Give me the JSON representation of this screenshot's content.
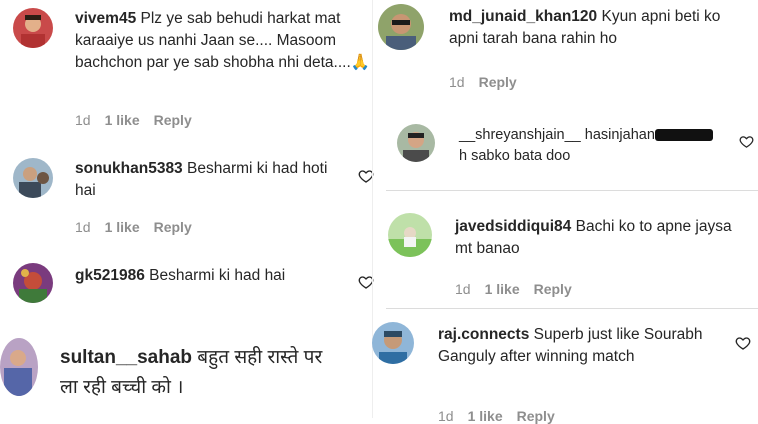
{
  "left": {
    "comments": [
      {
        "username": "vivem45",
        "text": "Plz ye sab behudi harkat mat karaaiye us nanhi Jaan se.... Masoom bachchon par ye sab shobha nhi deta....🙏",
        "time": "1d",
        "likes": "1 like",
        "reply": "Reply"
      },
      {
        "username": "sonukhan5383",
        "text": "Besharmi ki had hoti hai",
        "time": "1d",
        "likes": "1 like",
        "reply": "Reply"
      },
      {
        "username": "gk521986",
        "text": "Besharmi ki had hai"
      },
      {
        "username": "sultan__sahab",
        "text": "बहुत सही रास्ते पर ला रही बच्ची को ।"
      }
    ]
  },
  "right": {
    "comments": [
      {
        "username": "md_junaid_khan120",
        "text": "Kyun apni beti ko apni tarah bana rahin ho",
        "time": "1d",
        "reply": "Reply"
      },
      {
        "username": "__shreyanshjain__",
        "text_prefix": "hasinjahan",
        "text_suffix": "h sabko bata doo"
      },
      {
        "username": "javedsiddiqui84",
        "text": "Bachi ko to apne jaysa mt banao",
        "time": "1d",
        "likes": "1 like",
        "reply": "Reply"
      },
      {
        "username": "raj.connects",
        "text": "Superb just like Sourabh Ganguly after winning match",
        "time": "1d",
        "likes": "1 like",
        "reply": "Reply"
      }
    ]
  },
  "colors": {
    "text": "#262626",
    "meta": "#8e8e8e",
    "heart": "#262626"
  }
}
